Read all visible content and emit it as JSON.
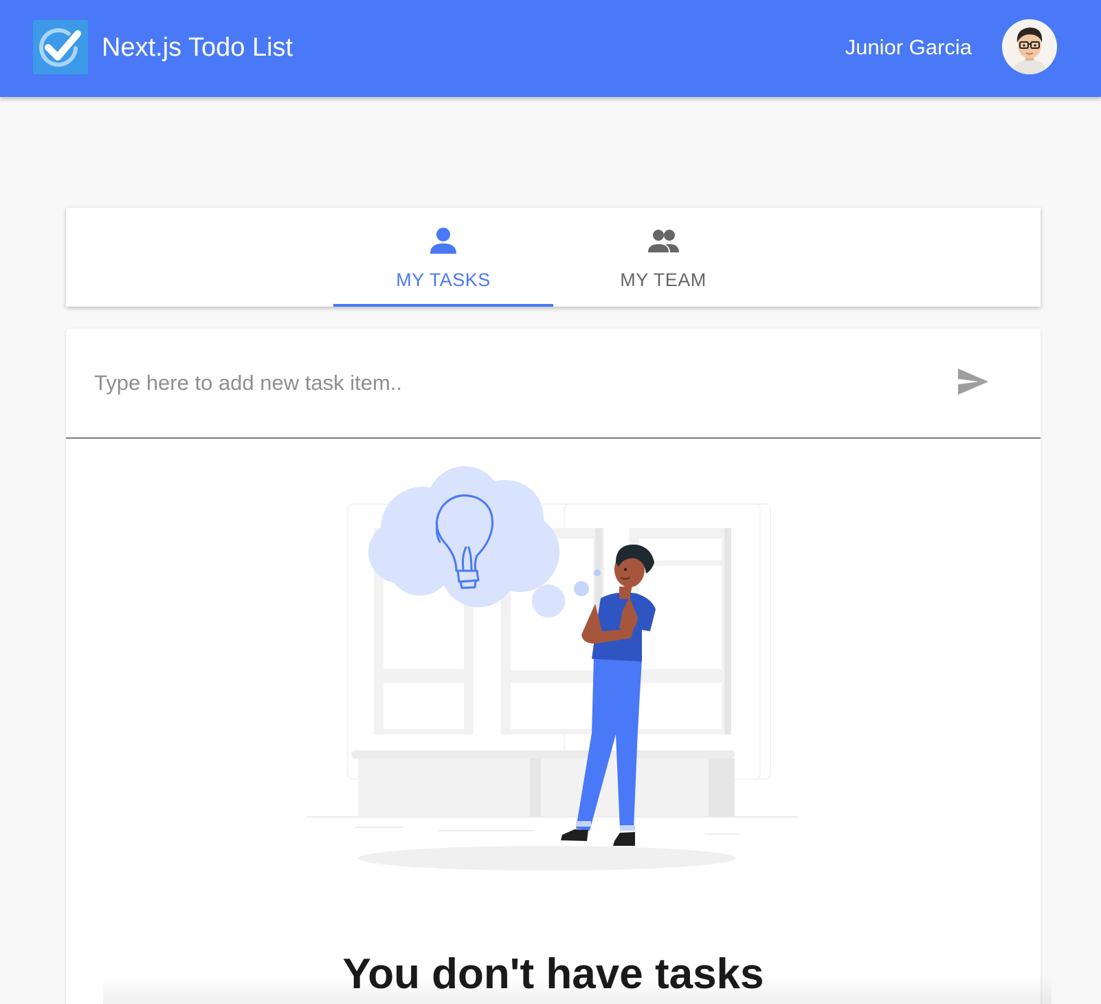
{
  "theme": {
    "primary": "#4979f6",
    "logo_bg": "#3d9ae8"
  },
  "header": {
    "logo_icon": "check-circle-icon",
    "title": "Next.js Todo List",
    "user_name": "Junior Garcia",
    "avatar_icon": "avatar-icon"
  },
  "tabs": [
    {
      "label": "MY TASKS",
      "icon": "person-icon",
      "selected": true
    },
    {
      "label": "MY TEAM",
      "icon": "people-icon",
      "selected": false
    }
  ],
  "task_input": {
    "placeholder": "Type here to add new task item..",
    "value": "",
    "submit_icon": "send-icon"
  },
  "empty_state": {
    "illustration": "thinking-person-illustration",
    "title": "You don't have tasks"
  }
}
